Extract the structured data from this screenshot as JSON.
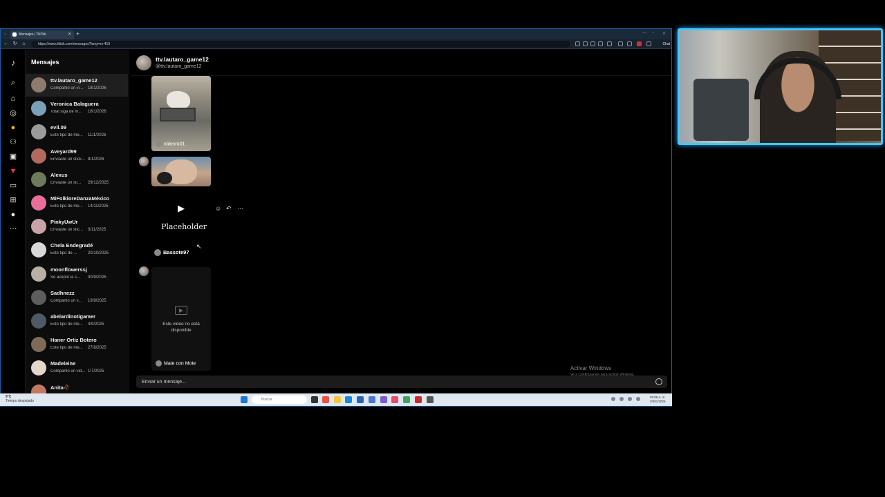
{
  "browser": {
    "tab_title": "Mensajes | TikTok",
    "url": "https://www.tiktok.com/messages?lang=es-419",
    "chat_button": "Chat"
  },
  "sidebar_title": "Mensajes",
  "conversations": [
    {
      "name": "ttv.lautaro_game12",
      "preview": "Compartió un vi...",
      "date": "18/1/2026"
    },
    {
      "name": "Veronica Balaguera",
      "preview": "Total siga de m...",
      "date": "18/1/2026"
    },
    {
      "name": "evil.09",
      "preview": "Este tipo de me...",
      "date": "11/1/2026"
    },
    {
      "name": "Aveyard99",
      "preview": "Enviaste un stick...",
      "date": "8/1/2026"
    },
    {
      "name": "Alexus",
      "preview": "Enviaste un sti...",
      "date": "29/12/2025"
    },
    {
      "name": "MiFolkloreDanzaMéxico",
      "preview": "Este tipo de me...",
      "date": "14/11/2025"
    },
    {
      "name": "PinkyUwUr",
      "preview": "Enviaste un stic...",
      "date": "3/11/2025"
    },
    {
      "name": "Chela Endegradé",
      "preview": "Este tipo de ...",
      "date": "20/10/2025"
    },
    {
      "name": "moonflowerssj",
      "preview": "Se aceptó la s...",
      "date": "30/9/2025"
    },
    {
      "name": "Sadhnezz",
      "preview": "Compartió un v...",
      "date": "19/9/2025"
    },
    {
      "name": "abelardinotigamer",
      "preview": "Este tipo de me...",
      "date": "4/9/2025"
    },
    {
      "name": "Haner Ortiz Botero",
      "preview": "Este tipo de me...",
      "date": "27/8/2025"
    },
    {
      "name": "Madeleine",
      "preview": "Compartió un vid...",
      "date": "1/7/2025"
    },
    {
      "name": "Anita🥀",
      "preview": "",
      "date": ""
    }
  ],
  "chat": {
    "name": "ttv.lautaro_game12",
    "handle": "@ttv.lautaro_game12",
    "video1_author": "valesro01",
    "placeholder_text": "Placeholder",
    "shared_author": "Bassote97",
    "unavailable_text": "Este video no está disponible",
    "video3_author": "Mate con Mote",
    "composer_placeholder": "Enviar un mensaje..."
  },
  "watermark": {
    "title": "Activar Windows",
    "subtitle": "Ve a Configuración para activar Windows."
  },
  "taskbar": {
    "weather_temp": "9°C",
    "weather_desc": "Tiempo despejado",
    "search_placeholder": "Buscar",
    "time": "02:09 a. m.",
    "date": "20/01/2026"
  },
  "colors": {
    "accent": "#46c6ff",
    "tiktok_red": "#fe2c55",
    "background": "#000000"
  }
}
